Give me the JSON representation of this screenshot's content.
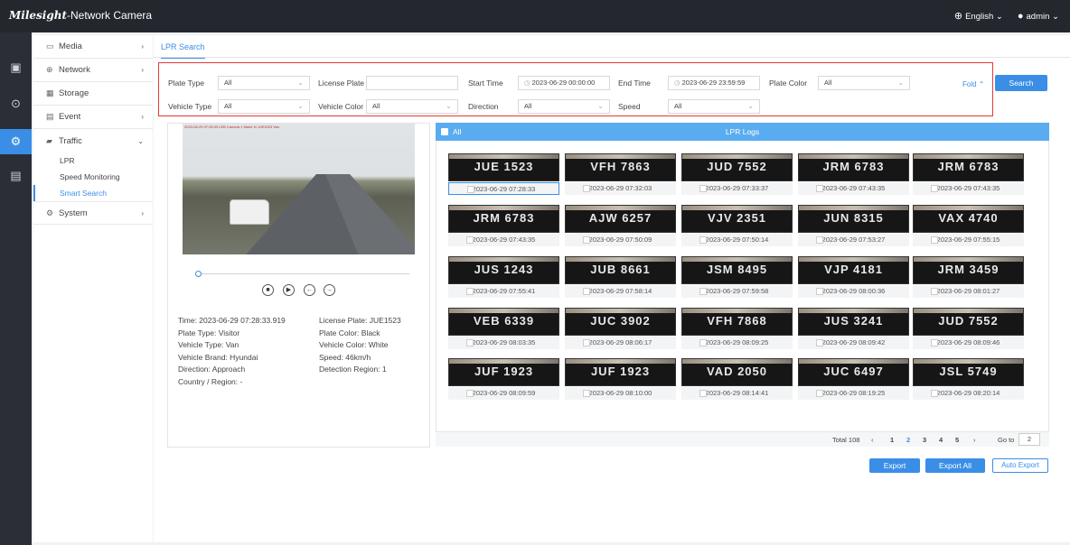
{
  "header": {
    "brand": "Milesight",
    "title": "-Network Camera",
    "language": "English",
    "user": "admin"
  },
  "sidebar": {
    "items": [
      {
        "label": "Media",
        "icon": "media-icon"
      },
      {
        "label": "Network",
        "icon": "network-icon"
      },
      {
        "label": "Storage",
        "icon": "storage-icon"
      },
      {
        "label": "Event",
        "icon": "event-icon"
      },
      {
        "label": "Traffic",
        "icon": "traffic-icon"
      }
    ],
    "traffic_sub": [
      "LPR",
      "Speed Monitoring",
      "Smart Search"
    ],
    "system": "System"
  },
  "tab": "LPR Search",
  "filters": {
    "plate_type_label": "Plate Type",
    "plate_type": "All",
    "license_plate_label": "License Plate",
    "license_plate": "",
    "start_time_label": "Start Time",
    "start_time": "2023-06-29 00:00:00",
    "end_time_label": "End Time",
    "end_time": "2023-06-29 23:59:59",
    "plate_color_label": "Plate Color",
    "plate_color": "All",
    "vehicle_type_label": "Vehicle Type",
    "vehicle_type": "All",
    "vehicle_color_label": "Vehicle Color",
    "vehicle_color": "All",
    "direction_label": "Direction",
    "direction": "All",
    "speed_label": "Speed",
    "speed": "All",
    "fold": "Fold",
    "search": "Search"
  },
  "video": {
    "overlay": "2023-06-29 07:28:33  LEB  Camera 1  Marie N  JUE1523  Van"
  },
  "details": {
    "left": [
      "Time: 2023-06-29 07:28:33.919",
      "Plate Type: Visitor",
      "Vehicle Type: Van",
      "Vehicle Brand: Hyundai",
      "Direction: Approach",
      "Country / Region: -"
    ],
    "right": [
      "License Plate: JUE1523",
      "Plate Color: Black",
      "Vehicle Color: White",
      "Speed: 46km/h",
      "Detection Region: 1"
    ]
  },
  "logs": {
    "all": "All",
    "title": "LPR Logs",
    "cards": [
      {
        "plate": "JUE 1523",
        "time": "2023-06-29 07:28:33"
      },
      {
        "plate": "VFH 7863",
        "time": "2023-06-29 07:32:03"
      },
      {
        "plate": "JUD 7552",
        "time": "2023-06-29 07:33:37"
      },
      {
        "plate": "JRM 6783",
        "time": "2023-06-29 07:43:35"
      },
      {
        "plate": "JRM 6783",
        "time": "2023-06-29 07:43:35"
      },
      {
        "plate": "JRM 6783",
        "time": "2023-06-29 07:43:35"
      },
      {
        "plate": "AJW 6257",
        "time": "2023-06-29 07:50:09"
      },
      {
        "plate": "VJV 2351",
        "time": "2023-06-29 07:50:14"
      },
      {
        "plate": "JUN 8315",
        "time": "2023-06-29 07:53:27"
      },
      {
        "plate": "VAX 4740",
        "time": "2023-06-29 07:55:15"
      },
      {
        "plate": "JUS 1243",
        "time": "2023-06-29 07:55:41"
      },
      {
        "plate": "JUB 8661",
        "time": "2023-06-29 07:58:14"
      },
      {
        "plate": "JSM 8495",
        "time": "2023-06-29 07:59:58"
      },
      {
        "plate": "VJP 4181",
        "time": "2023-06-29 08:00:36"
      },
      {
        "plate": "JRM 3459",
        "time": "2023-06-29 08:01:27"
      },
      {
        "plate": "VEB 6339",
        "time": "2023-06-29 08:03:35"
      },
      {
        "plate": "JUC 3902",
        "time": "2023-06-29 08:06:17"
      },
      {
        "plate": "VFH 7868",
        "time": "2023-06-29 08:09:25"
      },
      {
        "plate": "JUS 3241",
        "time": "2023-06-29 08:09:42"
      },
      {
        "plate": "JUD 7552",
        "time": "2023-06-29 08:09:46"
      },
      {
        "plate": "JUF 1923",
        "time": "2023-06-29 08:09:59"
      },
      {
        "plate": "JUF 1923",
        "time": "2023-06-29 08:10:00"
      },
      {
        "plate": "VAD 2050",
        "time": "2023-06-29 08:14:41"
      },
      {
        "plate": "JUC 6497",
        "time": "2023-06-29 08:19:25"
      },
      {
        "plate": "JSL 5749",
        "time": "2023-06-29 08:20:14"
      }
    ]
  },
  "pager": {
    "total": "Total 108",
    "pages": [
      "1",
      "2",
      "3",
      "4",
      "5"
    ],
    "current": "2",
    "goto_label": "Go to",
    "goto_value": "2"
  },
  "actions": {
    "export": "Export",
    "export_all": "Export All",
    "auto_export": "Auto Export"
  },
  "colors": {
    "accent": "#3a8ee6",
    "topbar": "#24272e",
    "filter_border": "#e53935"
  }
}
